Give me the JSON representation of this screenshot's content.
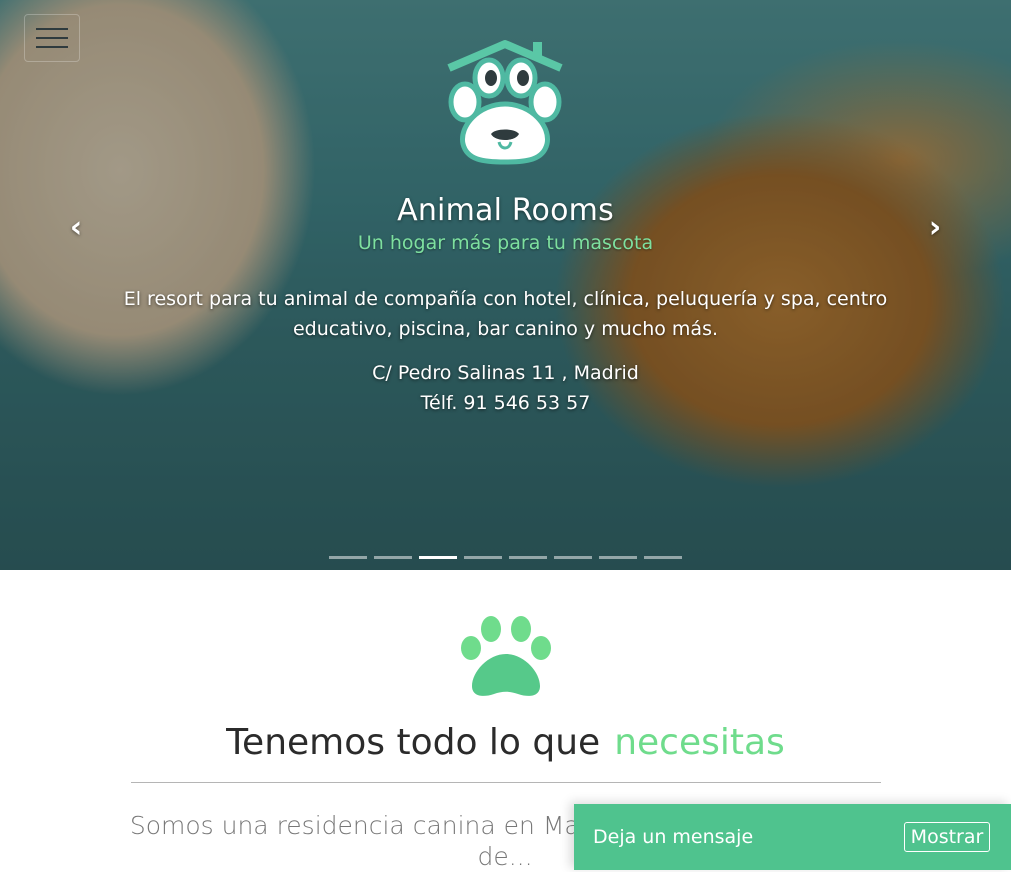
{
  "hero": {
    "title": "Animal Rooms",
    "subtitle": "Un hogar más para tu mascota",
    "description": "El resort para tu animal de compañía con hotel, clínica, peluquería y spa, centro educativo, piscina, bar canino y mucho más.",
    "address": "C/ Pedro Salinas 11 , Madrid",
    "phone": "Télf. 91 546 53 57",
    "prev_icon": "chevron-left-icon",
    "next_icon": "chevron-right-icon",
    "slide_count": 8,
    "active_slide_index": 2
  },
  "nav": {
    "menu_icon": "hamburger-menu-icon"
  },
  "section": {
    "icon": "paw-icon",
    "title_main": "Tenemos todo lo que",
    "title_accent": "necesitas",
    "text": "Somos una residencia canina en Mad... servicios a todo tipo de..."
  },
  "message_bar": {
    "label": "Deja un mensaje",
    "button_label": "Mostrar"
  },
  "colors": {
    "accent_green": "#6fdc8c",
    "bar_green": "#4fc38e",
    "logo_teal": "#4fb9a2"
  }
}
